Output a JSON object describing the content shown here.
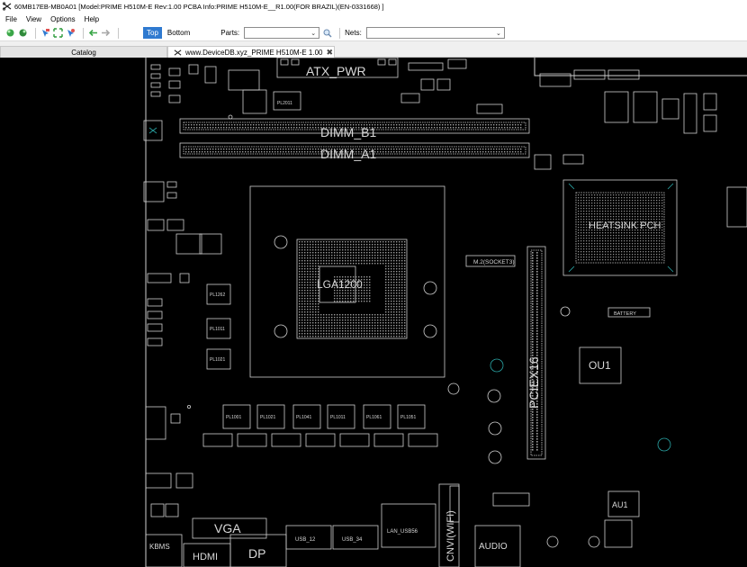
{
  "window": {
    "title": "60MB17EB-MB0A01 [Model:PRIME H510M-E  Rev:1.00 PCBA Info:PRIME H510M-E__R1.00(FOR BRAZIL)(EN-0331668) ]",
    "icon": "scissors-icon"
  },
  "menu": [
    "File",
    "View",
    "Options",
    "Help"
  ],
  "toolbar": {
    "icons": [
      "green-cube-icon",
      "green-cube-alt-icon",
      "select-icon",
      "fit-icon",
      "select-alt-icon",
      "back-arrow-icon",
      "forward-arrow-icon"
    ],
    "top_label": "Top",
    "bottom_label": "Bottom",
    "parts_label": "Parts:",
    "parts_value": "",
    "nets_label": "Nets:",
    "nets_value": ""
  },
  "tabs": {
    "catalog": "Catalog",
    "board": "www.DeviceDB.xyz_PRIME H510M-E 1.00"
  },
  "board": {
    "silkscreen_color": "#cfcfcf",
    "via_color": "#2aa6a6",
    "labels": {
      "atx_pwr": "ATX_PWR",
      "dimm_b1": "DIMM_B1",
      "dimm_a1": "DIMM_A1",
      "cpu": "LGA1200",
      "m2": "M.2(SOCKET3)",
      "pciex16": "PCIEX16",
      "heatsink": "HEATSINK PCH",
      "ou1": "OU1",
      "au1": "AU1",
      "battery": "BATTERY",
      "vga": "VGA",
      "dp": "DP",
      "hdmi": "HDMI",
      "kbms": "KBMS",
      "audio": "AUDIO",
      "cnvi": "CNVI(WIFI)",
      "usb1": "USB_12",
      "usb2": "USB_34",
      "lan": "LAN_USB56",
      "chokes": [
        "PL1001",
        "PL1021",
        "PL1041",
        "PL1011",
        "PL1061",
        "PL1051"
      ],
      "left_chokes": [
        "PL1262",
        "PL1011",
        "PL1021"
      ],
      "pl2011": "PL2011"
    }
  }
}
